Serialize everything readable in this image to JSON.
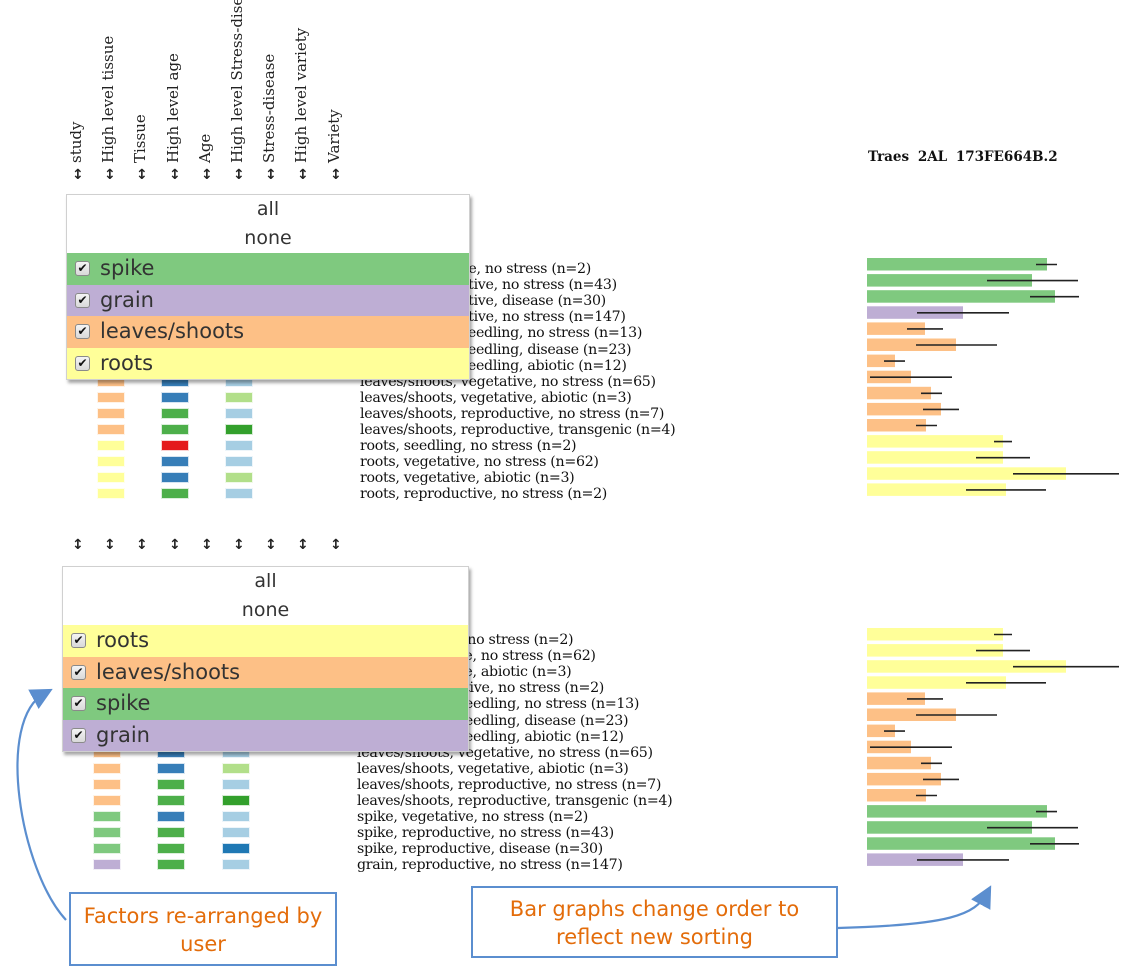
{
  "columns": [
    "study",
    "High level tissue",
    "Tissue",
    "High level age",
    "Age",
    "High level Stress-disea",
    "Stress-disease",
    "High level variety",
    "Variety"
  ],
  "sort_icon": "up-down-arrow-icon",
  "gene_title": "Traes  2AL  173FE664B.2",
  "colors": {
    "spike": "#7fc97f",
    "grain": "#beaed4",
    "leaves/shoots": "#fdc086",
    "roots": "#ffff99",
    "callout_border": "#5b8ecf",
    "callout_text": "#e36c0a"
  },
  "popup_top": {
    "all_label": "all",
    "none_label": "none",
    "items": [
      {
        "label": "spike",
        "checked": true
      },
      {
        "label": "grain",
        "checked": true
      },
      {
        "label": "leaves/shoots",
        "checked": true
      },
      {
        "label": "roots",
        "checked": true
      }
    ]
  },
  "popup_bottom": {
    "all_label": "all",
    "none_label": "none",
    "items": [
      {
        "label": "roots",
        "checked": true
      },
      {
        "label": "leaves/shoots",
        "checked": true
      },
      {
        "label": "spike",
        "checked": true
      },
      {
        "label": "grain",
        "checked": true
      }
    ]
  },
  "rows_top": [
    {
      "label": "spike, vegetative, no stress (n=2)",
      "tissue": "spike",
      "age": "#4daf4a",
      "stress": "#a6cee3"
    },
    {
      "label": "spike, reproductive, no stress (n=43)",
      "tissue": "spike",
      "age": "#4daf4a",
      "stress": "#a6cee3"
    },
    {
      "label": "spike, reproductive, disease (n=30)",
      "tissue": "spike",
      "age": "#4daf4a",
      "stress": "#1f78b4"
    },
    {
      "label": "grain, reproductive, no stress (n=147)",
      "tissue": "grain",
      "age": "#4daf4a",
      "stress": "#a6cee3"
    },
    {
      "label": "leaves/shoots, seedling, no stress (n=13)",
      "tissue": "leaves/shoots",
      "age": "#e41a1c",
      "stress": "#a6cee3"
    },
    {
      "label": "leaves/shoots, seedling, disease (n=23)",
      "tissue": "leaves/shoots",
      "age": "#e41a1c",
      "stress": "#1f78b4"
    },
    {
      "label": "leaves/shoots, seedling, abiotic (n=12)",
      "tissue": "leaves/shoots",
      "age": "#e41a1c",
      "stress": "#b2df8a"
    },
    {
      "label": "leaves/shoots, vegetative, no stress (n=65)",
      "tissue": "leaves/shoots",
      "age": "#377eb8",
      "stress": "#a6cee3"
    },
    {
      "label": "leaves/shoots, vegetative, abiotic (n=3)",
      "tissue": "leaves/shoots",
      "age": "#377eb8",
      "stress": "#b2df8a"
    },
    {
      "label": "leaves/shoots, reproductive, no stress (n=7)",
      "tissue": "leaves/shoots",
      "age": "#4daf4a",
      "stress": "#a6cee3"
    },
    {
      "label": "leaves/shoots, reproductive, transgenic (n=4)",
      "tissue": "leaves/shoots",
      "age": "#4daf4a",
      "stress": "#33a02c"
    },
    {
      "label": "roots, seedling, no stress (n=2)",
      "tissue": "roots",
      "age": "#e41a1c",
      "stress": "#a6cee3"
    },
    {
      "label": "roots, vegetative, no stress (n=62)",
      "tissue": "roots",
      "age": "#377eb8",
      "stress": "#a6cee3"
    },
    {
      "label": "roots, vegetative, abiotic (n=3)",
      "tissue": "roots",
      "age": "#377eb8",
      "stress": "#b2df8a"
    },
    {
      "label": "roots, reproductive, no stress (n=2)",
      "tissue": "roots",
      "age": "#4daf4a",
      "stress": "#a6cee3"
    }
  ],
  "rows_bottom": [
    {
      "label": "roots, seedling, no stress (n=2)",
      "tissue": "roots",
      "age": "#e41a1c",
      "stress": "#a6cee3"
    },
    {
      "label": "roots, vegetative, no stress (n=62)",
      "tissue": "roots",
      "age": "#377eb8",
      "stress": "#a6cee3"
    },
    {
      "label": "roots, vegetative, abiotic (n=3)",
      "tissue": "roots",
      "age": "#377eb8",
      "stress": "#b2df8a"
    },
    {
      "label": "roots, reproductive, no stress (n=2)",
      "tissue": "roots",
      "age": "#4daf4a",
      "stress": "#a6cee3"
    },
    {
      "label": "leaves/shoots, seedling, no stress (n=13)",
      "tissue": "leaves/shoots",
      "age": "#e41a1c",
      "stress": "#a6cee3"
    },
    {
      "label": "leaves/shoots, seedling, disease (n=23)",
      "tissue": "leaves/shoots",
      "age": "#e41a1c",
      "stress": "#1f78b4"
    },
    {
      "label": "leaves/shoots, seedling, abiotic (n=12)",
      "tissue": "leaves/shoots",
      "age": "#e41a1c",
      "stress": "#b2df8a"
    },
    {
      "label": "leaves/shoots, vegetative, no stress (n=65)",
      "tissue": "leaves/shoots",
      "age": "#377eb8",
      "stress": "#a6cee3"
    },
    {
      "label": "leaves/shoots, vegetative, abiotic (n=3)",
      "tissue": "leaves/shoots",
      "age": "#377eb8",
      "stress": "#b2df8a"
    },
    {
      "label": "leaves/shoots, reproductive, no stress (n=7)",
      "tissue": "leaves/shoots",
      "age": "#4daf4a",
      "stress": "#a6cee3"
    },
    {
      "label": "leaves/shoots, reproductive, transgenic (n=4)",
      "tissue": "leaves/shoots",
      "age": "#4daf4a",
      "stress": "#33a02c"
    },
    {
      "label": "spike, vegetative, no stress (n=2)",
      "tissue": "spike",
      "age": "#377eb8",
      "stress": "#a6cee3"
    },
    {
      "label": "spike, reproductive, no stress (n=43)",
      "tissue": "spike",
      "age": "#4daf4a",
      "stress": "#a6cee3"
    },
    {
      "label": "spike, reproductive, disease (n=30)",
      "tissue": "spike",
      "age": "#4daf4a",
      "stress": "#1f78b4"
    },
    {
      "label": "grain, reproductive, no stress (n=147)",
      "tissue": "grain",
      "age": "#4daf4a",
      "stress": "#a6cee3"
    }
  ],
  "chart_data": [
    {
      "type": "bar",
      "orientation": "horizontal",
      "title": "Traes  2AL  173FE664B.2",
      "xlabel": "",
      "ylabel": "",
      "xlim": [
        0,
        13
      ],
      "grid": false,
      "categories": [
        "spike, vegetative, no stress (n=2)",
        "spike, reproductive, no stress (n=43)",
        "spike, reproductive, disease (n=30)",
        "grain, reproductive, no stress (n=147)",
        "leaves/shoots, seedling, no stress (n=13)",
        "leaves/shoots, seedling, disease (n=23)",
        "leaves/shoots, seedling, abiotic (n=12)",
        "leaves/shoots, vegetative, no stress (n=65)",
        "leaves/shoots, vegetative, abiotic (n=3)",
        "leaves/shoots, reproductive, no stress (n=7)",
        "leaves/shoots, reproductive, transgenic (n=4)",
        "roots, seedling, no stress (n=2)",
        "roots, vegetative, no stress (n=62)",
        "roots, vegetative, abiotic (n=3)",
        "roots, reproductive, no stress (n=2)"
      ],
      "groups": [
        "spike",
        "spike",
        "spike",
        "grain",
        "leaves/shoots",
        "leaves/shoots",
        "leaves/shoots",
        "leaves/shoots",
        "leaves/shoots",
        "leaves/shoots",
        "leaves/shoots",
        "roots",
        "roots",
        "roots",
        "roots"
      ],
      "values": [
        9.0,
        8.25,
        9.4,
        4.8,
        2.9,
        4.45,
        1.4,
        2.2,
        3.2,
        3.7,
        2.95,
        6.8,
        6.8,
        9.95,
        6.95
      ],
      "error_low": [
        8.45,
        6.0,
        8.15,
        2.5,
        2.0,
        2.45,
        0.85,
        0.15,
        2.7,
        2.8,
        2.45,
        6.35,
        5.45,
        7.3,
        4.95
      ],
      "error_high": [
        9.5,
        10.55,
        10.6,
        7.1,
        3.8,
        6.5,
        1.9,
        4.25,
        3.75,
        4.6,
        3.5,
        7.25,
        8.15,
        12.6,
        8.95
      ]
    },
    {
      "type": "bar",
      "orientation": "horizontal",
      "title": "",
      "xlabel": "",
      "ylabel": "",
      "xlim": [
        0,
        13
      ],
      "grid": false,
      "categories": [
        "roots, seedling, no stress (n=2)",
        "roots, vegetative, no stress (n=62)",
        "roots, vegetative, abiotic (n=3)",
        "roots, reproductive, no stress (n=2)",
        "leaves/shoots, seedling, no stress (n=13)",
        "leaves/shoots, seedling, disease (n=23)",
        "leaves/shoots, seedling, abiotic (n=12)",
        "leaves/shoots, vegetative, no stress (n=65)",
        "leaves/shoots, vegetative, abiotic (n=3)",
        "leaves/shoots, reproductive, no stress (n=7)",
        "leaves/shoots, reproductive, transgenic (n=4)",
        "spike, vegetative, no stress (n=2)",
        "spike, reproductive, no stress (n=43)",
        "spike, reproductive, disease (n=30)",
        "grain, reproductive, no stress (n=147)"
      ],
      "groups": [
        "roots",
        "roots",
        "roots",
        "roots",
        "leaves/shoots",
        "leaves/shoots",
        "leaves/shoots",
        "leaves/shoots",
        "leaves/shoots",
        "leaves/shoots",
        "leaves/shoots",
        "spike",
        "spike",
        "spike",
        "grain"
      ],
      "values": [
        6.8,
        6.8,
        9.95,
        6.95,
        2.9,
        4.45,
        1.4,
        2.2,
        3.2,
        3.7,
        2.95,
        9.0,
        8.25,
        9.4,
        4.8
      ],
      "error_low": [
        6.35,
        5.45,
        7.3,
        4.95,
        2.0,
        2.45,
        0.85,
        0.15,
        2.7,
        2.8,
        2.45,
        8.45,
        6.0,
        8.15,
        2.5
      ],
      "error_high": [
        7.25,
        8.15,
        12.6,
        8.95,
        3.8,
        6.5,
        1.9,
        4.25,
        3.75,
        4.6,
        3.5,
        9.5,
        10.55,
        10.6,
        7.1
      ]
    }
  ],
  "callouts": {
    "left": "Factors re-arranged by user",
    "right": "Bar graphs change order to reflect new sorting"
  }
}
